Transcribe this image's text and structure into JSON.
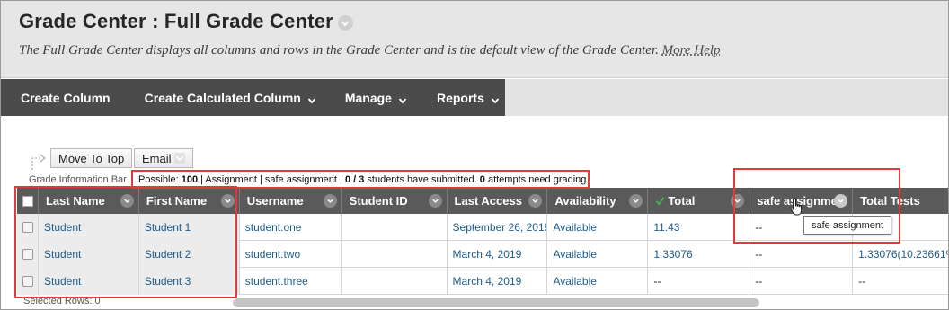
{
  "header": {
    "title": "Grade Center : Full Grade Center",
    "description": "The Full Grade Center displays all columns and rows in the Grade Center and is the default view of the Grade Center.",
    "more_help": "More Help"
  },
  "action_bar": {
    "items": [
      {
        "label": "Create Column",
        "dropdown": false
      },
      {
        "label": "Create Calculated Column",
        "dropdown": true
      },
      {
        "label": "Manage",
        "dropdown": true
      },
      {
        "label": "Reports",
        "dropdown": true
      }
    ]
  },
  "toolbar": {
    "move_to_top": "Move To Top",
    "email": "Email"
  },
  "info_bar": {
    "label": "Grade Information Bar",
    "text_prefix": "Possible: ",
    "possible": "100",
    "text_mid1": " | Assignment | safe assignment | ",
    "submitted": "0 / 3",
    "text_mid2": " students have submitted. ",
    "attempts": "0",
    "text_end": " attempts need grading."
  },
  "grid": {
    "columns": [
      "Last Name",
      "First Name",
      "Username",
      "Student ID",
      "Last Access",
      "Availability",
      "Total",
      "safe assignme",
      "Total Tests"
    ],
    "rows": [
      {
        "last": "Student",
        "first": "Student 1",
        "username": "student.one",
        "student_id": "",
        "last_access": "September 26, 2019",
        "availability": "Available",
        "total": "11.43",
        "safe": "--",
        "total_tests": "00%)"
      },
      {
        "last": "Student",
        "first": "Student 2",
        "username": "student.two",
        "student_id": "",
        "last_access": "March 4, 2019",
        "availability": "Available",
        "total": "1.33076",
        "safe": "--",
        "total_tests": "1.33076(10.23661%"
      },
      {
        "last": "Student",
        "first": "Student 3",
        "username": "student.three",
        "student_id": "",
        "last_access": "March 4, 2019",
        "availability": "Available",
        "total": "--",
        "safe": "--",
        "total_tests": "--"
      }
    ],
    "selected_rows": "Selected Rows: 0"
  },
  "tooltip": "safe assignment",
  "colors": {
    "header_bg": "#e6e6e6",
    "action_bar_bg": "#4b4b4b",
    "grid_header_bg": "#5a5a5a",
    "link": "#1d5c8c",
    "highlight": "#e03a3a",
    "total_check": "#4caf50",
    "sort_arrow": "#f2b43b"
  }
}
